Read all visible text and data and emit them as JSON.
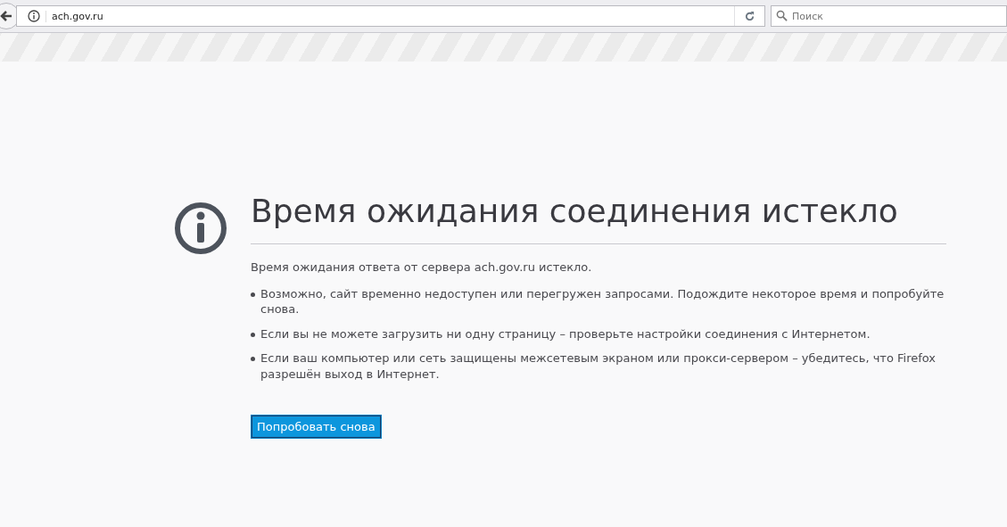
{
  "toolbar": {
    "url": "ach.gov.ru",
    "search": {
      "placeholder": "Поиск"
    }
  },
  "error": {
    "title": "Время ожидания соединения истекло",
    "message": "Время ожидания ответа от сервера ach.gov.ru истекло.",
    "tips": [
      "Возможно, сайт временно недоступен или перегружен запросами. Подождите некоторое время и попробуйте снова.",
      "Если вы не можете загрузить ни одну страницу – проверьте настройки соединения с Интернетом.",
      "Если ваш компьютер или сеть защищены межсетевым экраном или прокси-сервером – убедитесь, что Firefox разрешён выход в Интернет."
    ],
    "button": "Попробовать снова"
  }
}
